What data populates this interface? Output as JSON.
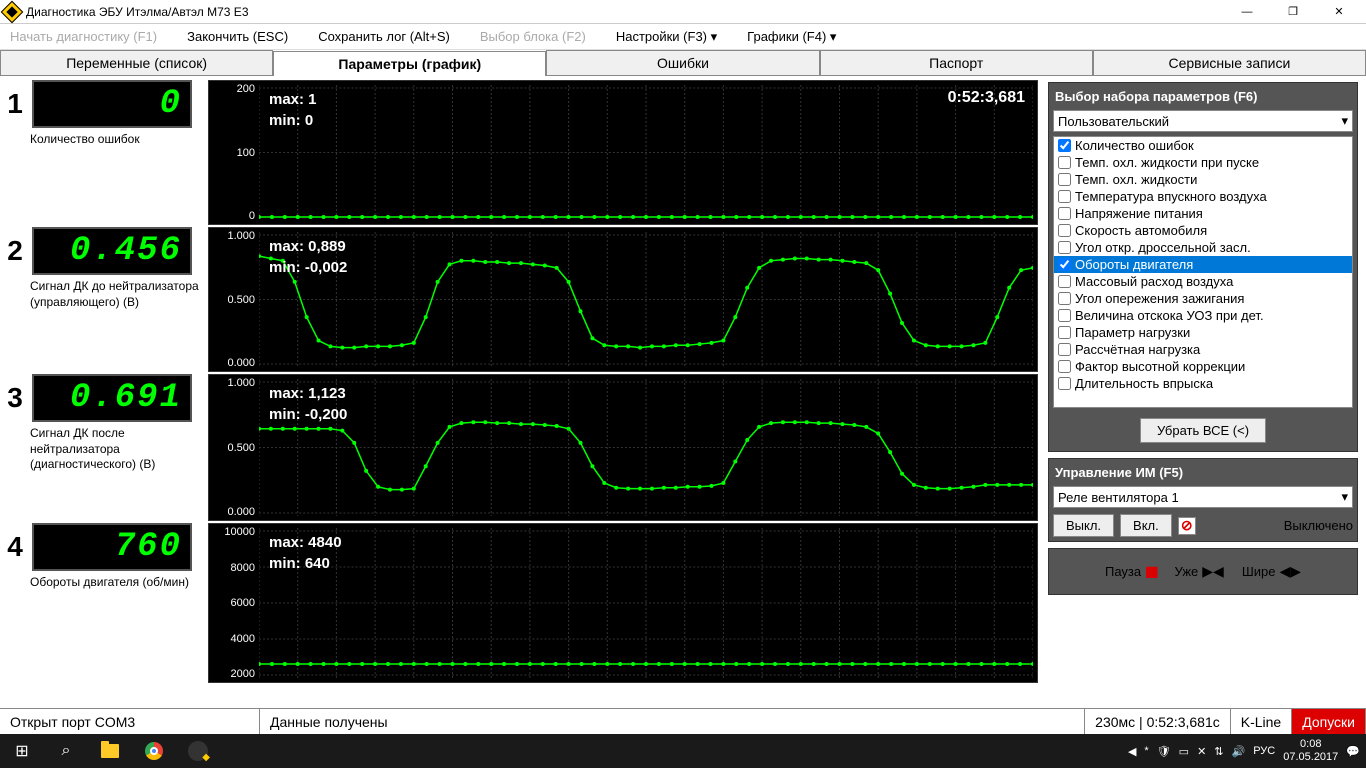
{
  "window": {
    "title": "Диагностика ЭБУ Итэлма/Автэл M73 E3"
  },
  "menu": {
    "start": "Начать диагностику (F1)",
    "stop": "Закончить (ESC)",
    "savelog": "Сохранить лог (Alt+S)",
    "block": "Выбор блока (F2)",
    "settings": "Настройки (F3) ▾",
    "charts": "Графики (F4) ▾"
  },
  "tabs": {
    "vars": "Переменные (список)",
    "params": "Параметры (график)",
    "errors": "Ошибки",
    "passport": "Паспорт",
    "service": "Сервисные записи"
  },
  "rows": [
    {
      "n": "1",
      "val": "0",
      "label": "Количество ошибок",
      "max": "max: 1",
      "min": "min: 0",
      "time": "0:52:3,681",
      "yticks": [
        "200",
        "100",
        "0"
      ],
      "h": 145
    },
    {
      "n": "2",
      "val": "0.456",
      "label": "Сигнал ДК до нейтрализатора (управляющего) (В)",
      "max": "max: 0,889",
      "min": "min: -0,002",
      "yticks": [
        "1.000",
        "0.500",
        "0.000"
      ],
      "h": 145
    },
    {
      "n": "3",
      "val": "0.691",
      "label": "Сигнал ДК после нейтрализатора (диагностического) (В)",
      "max": "max: 1,123",
      "min": "min: -0,200",
      "yticks": [
        "1.000",
        "0.500",
        "0.000"
      ],
      "h": 147
    },
    {
      "n": "4",
      "val": "760",
      "label": "Обороты двигателя (об/мин)",
      "max": "max: 4840",
      "min": "min: 640",
      "yticks": [
        "10000",
        "8000",
        "6000",
        "4000",
        "2000"
      ],
      "h": 160
    }
  ],
  "paramsel": {
    "title": "Выбор набора параметров (F6)",
    "preset": "Пользовательский",
    "items": [
      {
        "label": "Количество ошибок",
        "checked": true
      },
      {
        "label": "Темп. охл. жидкости при пуске",
        "checked": false
      },
      {
        "label": "Темп. охл. жидкости",
        "checked": false
      },
      {
        "label": "Температура впускного воздуха",
        "checked": false
      },
      {
        "label": "Напряжение питания",
        "checked": false
      },
      {
        "label": "Скорость автомобиля",
        "checked": false
      },
      {
        "label": "Угол откр. дроссельной засл.",
        "checked": false
      },
      {
        "label": "Обороты двигателя",
        "checked": true,
        "selected": true
      },
      {
        "label": "Массовый расход воздуха",
        "checked": false
      },
      {
        "label": "Угол опережения зажигания",
        "checked": false
      },
      {
        "label": "Величина отскока УОЗ при дет.",
        "checked": false
      },
      {
        "label": "Параметр нагрузки",
        "checked": false
      },
      {
        "label": "Рассчётная нагрузка",
        "checked": false
      },
      {
        "label": "Фактор высотной коррекции",
        "checked": false
      },
      {
        "label": "Длительность впрыска",
        "checked": false
      }
    ],
    "remove": "Убрать ВСЕ (<)"
  },
  "im": {
    "title": "Управление ИМ (F5)",
    "device": "Реле вентилятора 1",
    "off": "Выкл.",
    "on": "Вкл.",
    "status": "Выключено"
  },
  "play": {
    "pause": "Пауза",
    "narrow": "Уже",
    "wide": "Шире"
  },
  "status": {
    "port": "Открыт порт COM3",
    "data": "Данные получены",
    "lat": "230мс",
    "time": "0:52:3,681с",
    "line": "K-Line",
    "tol": "Допуски"
  },
  "taskbar": {
    "lang": "РУС",
    "time": "0:08",
    "date": "07.05.2017"
  },
  "chart_data": [
    {
      "type": "line",
      "title": "Количество ошибок",
      "ylim": [
        0,
        250
      ],
      "max": 1,
      "min": 0,
      "values_flat_at": 0
    },
    {
      "type": "line",
      "title": "Сигнал ДК до нейтрализатора (В)",
      "ylim": [
        -0.1,
        1.0
      ],
      "max": 0.889,
      "min": -0.002,
      "y": [
        0.82,
        0.8,
        0.78,
        0.6,
        0.3,
        0.1,
        0.05,
        0.04,
        0.04,
        0.05,
        0.05,
        0.05,
        0.06,
        0.08,
        0.3,
        0.6,
        0.75,
        0.78,
        0.78,
        0.77,
        0.77,
        0.76,
        0.76,
        0.75,
        0.74,
        0.72,
        0.6,
        0.35,
        0.12,
        0.06,
        0.05,
        0.05,
        0.04,
        0.05,
        0.05,
        0.06,
        0.06,
        0.07,
        0.08,
        0.1,
        0.3,
        0.55,
        0.72,
        0.78,
        0.79,
        0.8,
        0.8,
        0.79,
        0.79,
        0.78,
        0.77,
        0.76,
        0.7,
        0.5,
        0.25,
        0.1,
        0.06,
        0.05,
        0.05,
        0.05,
        0.06,
        0.08,
        0.3,
        0.55,
        0.7,
        0.72
      ]
    },
    {
      "type": "line",
      "title": "Сигнал ДК после нейтрализатора (В)",
      "ylim": [
        -0.2,
        1.2
      ],
      "max": 1.123,
      "min": -0.2,
      "y": [
        0.7,
        0.7,
        0.7,
        0.7,
        0.7,
        0.7,
        0.7,
        0.68,
        0.55,
        0.25,
        0.08,
        0.05,
        0.05,
        0.06,
        0.3,
        0.55,
        0.72,
        0.76,
        0.77,
        0.77,
        0.76,
        0.76,
        0.75,
        0.75,
        0.74,
        0.73,
        0.7,
        0.55,
        0.3,
        0.12,
        0.07,
        0.06,
        0.06,
        0.06,
        0.07,
        0.07,
        0.08,
        0.08,
        0.09,
        0.12,
        0.35,
        0.58,
        0.72,
        0.76,
        0.77,
        0.77,
        0.77,
        0.76,
        0.76,
        0.75,
        0.74,
        0.72,
        0.65,
        0.45,
        0.22,
        0.1,
        0.07,
        0.06,
        0.06,
        0.07,
        0.08,
        0.1,
        0.1,
        0.1,
        0.1,
        0.1
      ]
    },
    {
      "type": "line",
      "title": "Обороты двигателя (об/мин)",
      "ylim": [
        0,
        10000
      ],
      "max": 4840,
      "min": 640,
      "values_flat_at": 760
    }
  ]
}
